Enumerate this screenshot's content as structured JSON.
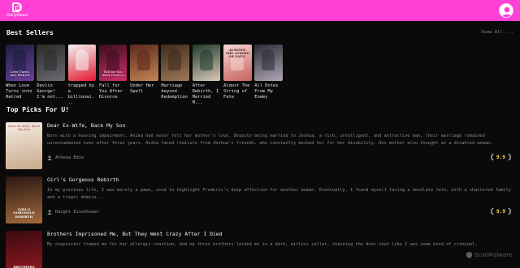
{
  "app": {
    "name": "DailyRead",
    "brand_color": "#ff3fd6"
  },
  "header": {
    "logo_icon": "book-logo-icon",
    "user_icon": "user-avatar-icon"
  },
  "best_sellers": {
    "title": "Best Sellers",
    "view_all": "View All ...",
    "books": [
      {
        "title": "When Love Turns into Hatred",
        "cover_text": "Love Turns into Hatred",
        "colors": [
          "#1a1f3a",
          "#6c3fa0"
        ]
      },
      {
        "title": "Devlin George! I'm not...",
        "cover_text": "",
        "colors": [
          "#2b2b2b",
          "#6a6a70"
        ]
      },
      {
        "title": "trapped by a billionai...",
        "cover_text": "",
        "colors": [
          "#f4f4f4",
          "#e4172e"
        ]
      },
      {
        "title": "Fall for You After Divorce",
        "cover_text": "Fall for You After Divorce",
        "colors": [
          "#3a0f1f",
          "#d42c6a"
        ]
      },
      {
        "title": "Under Her Spell",
        "cover_text": "",
        "colors": [
          "#5a2a1a",
          "#c58456"
        ]
      },
      {
        "title": "Marriage beyond Redemption",
        "cover_text": "",
        "colors": [
          "#3d2a1c",
          "#a07a56"
        ]
      },
      {
        "title": "After Rebirth, I Married M...",
        "cover_text": "",
        "colors": [
          "#1f3a2c",
          "#d9c9b6"
        ]
      },
      {
        "title": "Almost The String of Fate",
        "cover_text": "ALMOST: THE STRING OF FATE.",
        "colors": [
          "#f7d6d3",
          "#c7625e"
        ]
      },
      {
        "title": "All Dotes From My Enemy",
        "cover_text": "",
        "colors": [
          "#2c2c34",
          "#b0a8b8"
        ]
      }
    ]
  },
  "top_picks": {
    "title": "Top Picks For U!",
    "items": [
      {
        "title": "Dear Ex-Wife, Back My Son",
        "description": "Born with a hearing impairment, Anika had never felt her mother's love. Despite being married to Joshua, a rich, intelligent, and attractive man, their marriage remained unconsummated even after three years. Anika faced ridicule from Joshua's friends, who constantly mocked her for her disability. His mother also thought as a disabled woman, Anika...",
        "author": "Athena Edie",
        "rating": "9.9",
        "cover_text": "Dear Ex-Wife, Back My Son",
        "colors": [
          "#f3ece2",
          "#c9a98a"
        ]
      },
      {
        "title": "Girl's Gorgeous Rebirth",
        "description": "In my previous life, I was merely a pawn, used to highlight Frederic's deep affection for another woman. Eventually, I found myself facing a desolate fate, with a shattered family and a tragic demise...",
        "author": "Dwight Eisenhower",
        "rating": "9.9",
        "cover_text": "GIRL'S GORGEOUS REBIRTH",
        "colors": [
          "#2a1712",
          "#a36a3c"
        ]
      },
      {
        "title": "Brothers Imprisoned Me, But They Went Crazy After I Died",
        "description": "My stepsister framed me for her allergic reaction, and my three brothers locked me in a dark, airless cellar, chaining the door shut like I was some kind of criminal.",
        "author": "",
        "rating": "",
        "cover_text": "BROTHERS IMPRISONED ME",
        "colors": [
          "#3a0b10",
          "#9a1b22"
        ]
      }
    ]
  },
  "overlay": {
    "watermark": "ScanMalware"
  },
  "colors": {
    "rating": "#ffd84d",
    "background": "#0a0a0a"
  }
}
